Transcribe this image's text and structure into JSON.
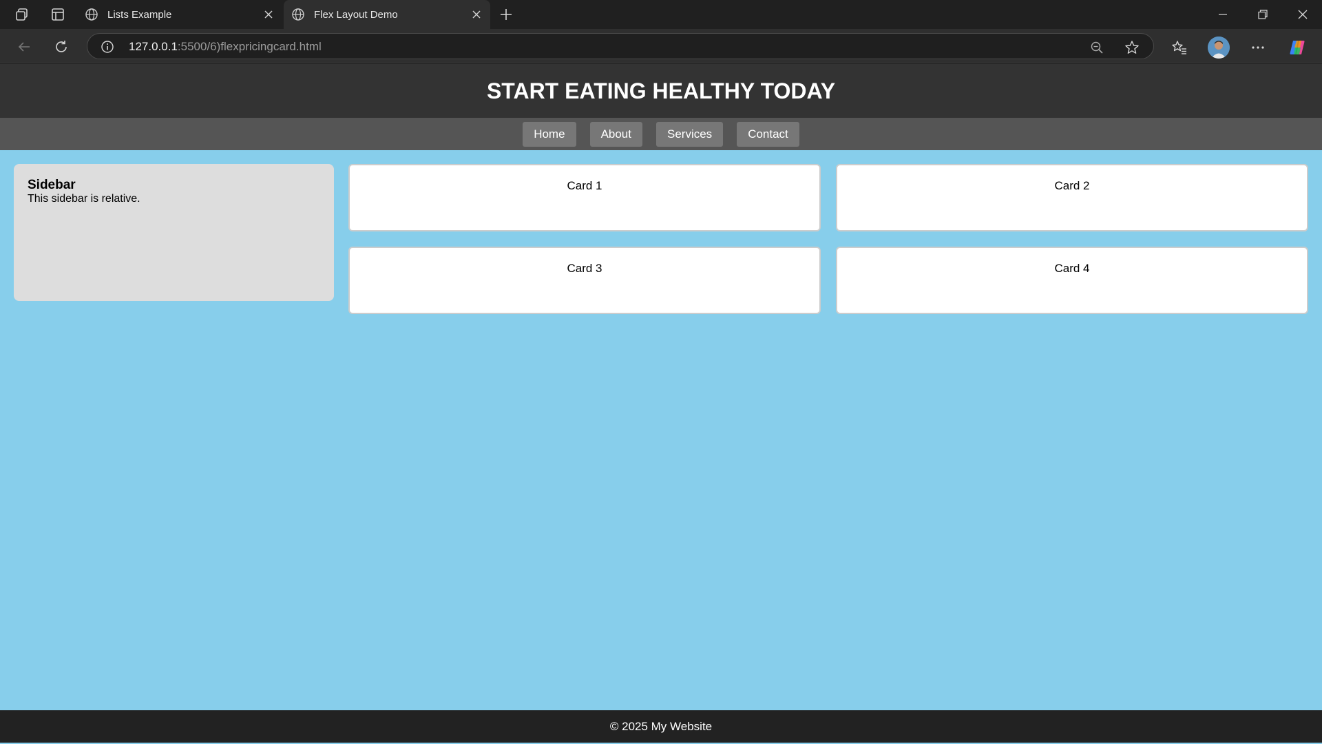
{
  "browser": {
    "tabs": [
      {
        "title": "Lists Example",
        "active": false
      },
      {
        "title": "Flex Layout Demo",
        "active": true
      }
    ],
    "url_host": "127.0.0.1",
    "url_rest": ":5500/6)flexpricingcard.html"
  },
  "site": {
    "title": "START EATING HEALTHY TODAY",
    "nav": [
      "Home",
      "About",
      "Services",
      "Contact"
    ],
    "sidebar": {
      "heading": "Sidebar",
      "text": "This sidebar is relative."
    },
    "cards": [
      "Card 1",
      "Card 2",
      "Card 3",
      "Card 4"
    ],
    "footer": "© 2025 My Website"
  },
  "colors": {
    "page_background": "#87ceeb",
    "header": "#333333",
    "nav_bar": "#555555",
    "nav_button": "#777777",
    "sidebar": "#dddddd",
    "footer": "#222222"
  }
}
